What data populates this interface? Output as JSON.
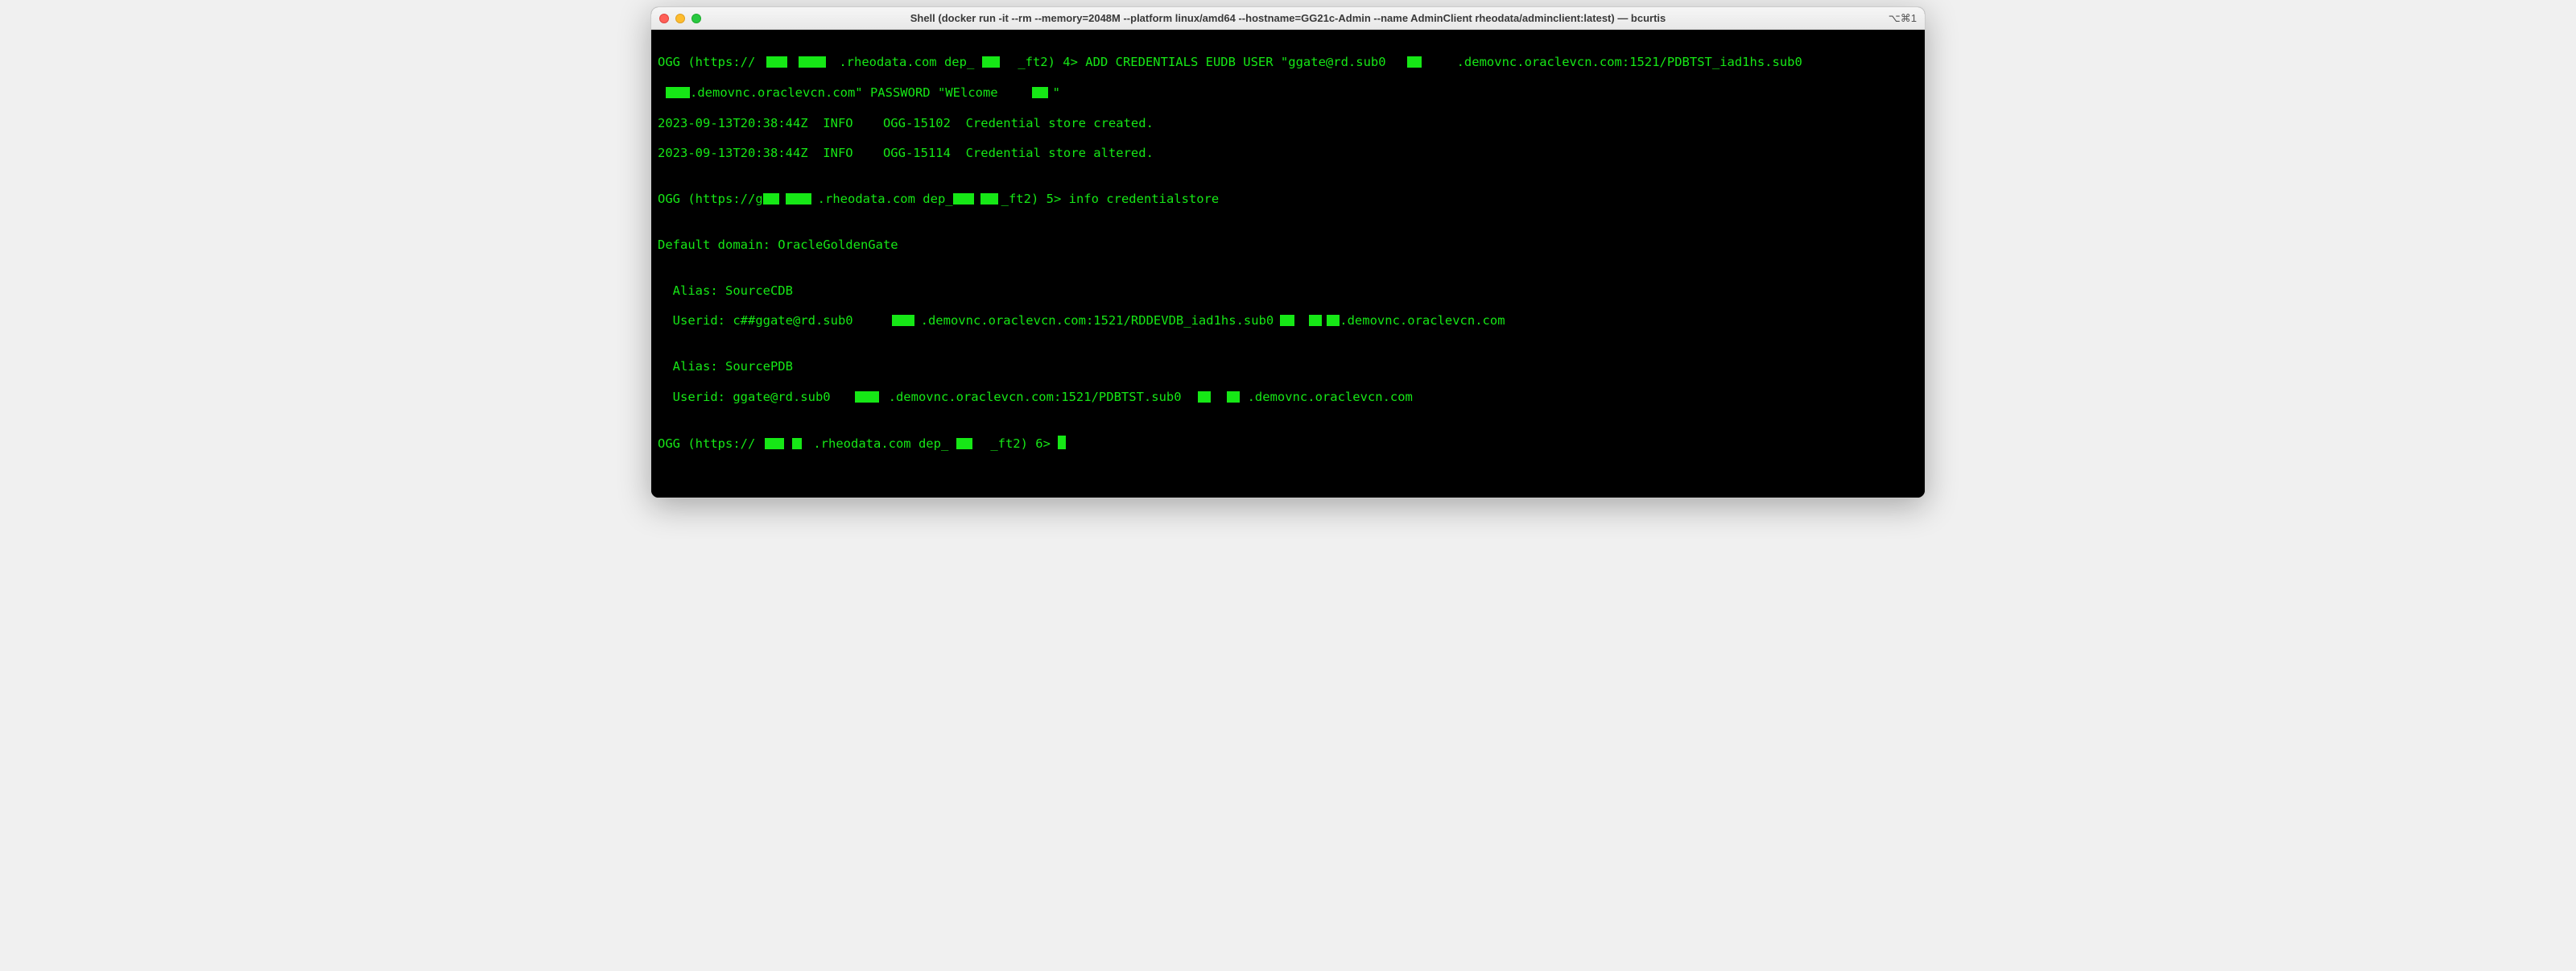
{
  "titlebar": {
    "title": "Shell (docker run -it --rm --memory=2048M --platform linux/amd64 --hostname=GG21c-Admin --name AdminClient rheodata/adminclient:latest) — bcurtis",
    "shortcut": "⌥⌘1"
  },
  "term": {
    "l1a": "OGG (https://",
    "l1b": ".rheodata.com dep_",
    "l1c": "_ft2) 4> ADD CREDENTIALS EUDB USER \"ggate@rd.sub0",
    "l1d": ".demovnc.oraclevcn.com:1521/PDBTST_iad1hs.sub0",
    "l2a": ".demovnc.oraclevcn.com\" PASSWORD \"WElcome",
    "l2b": "\"",
    "l3": "2023-09-13T20:38:44Z  INFO    OGG-15102  Credential store created.",
    "l4": "2023-09-13T20:38:44Z  INFO    OGG-15114  Credential store altered.",
    "l5": "",
    "l6a": "OGG (https://g",
    "l6b": ".rheodata.com dep_",
    "l6c": "_ft2) 5> info credentialstore",
    "l7": "",
    "l8": "Default domain: OracleGoldenGate",
    "l9": "",
    "l10": "  Alias: SourceCDB",
    "l11a": "  Userid: c##ggate@rd.sub0",
    "l11b": ".demovnc.oraclevcn.com:1521/RDDEVDB_iad1hs.sub0",
    "l11c": ".demovnc.oraclevcn.com",
    "l12": "",
    "l13": "  Alias: SourcePDB",
    "l14a": "  Userid: ggate@rd.sub0",
    "l14b": ".demovnc.oraclevcn.com:1521/PDBTST.sub0",
    "l14c": ".demovnc.oraclevcn.com",
    "l15": "",
    "l16a": "OGG (https://",
    "l16b": ".rheodata.com dep_",
    "l16c": "_ft2) 6> "
  }
}
